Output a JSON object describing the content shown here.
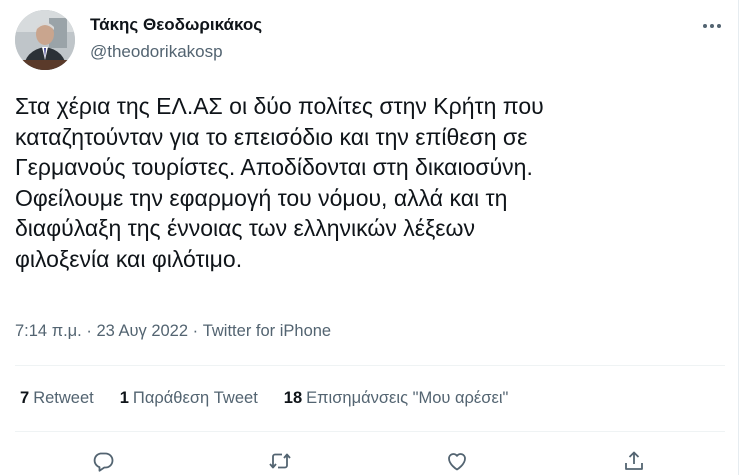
{
  "author": {
    "name": "Τάκης Θεοδωρικάκος",
    "handle": "@theodorikakosp"
  },
  "tweet": {
    "text": "Στα χέρια της ΕΛ.ΑΣ οι δύο πολίτες στην Κρήτη που\nκαταζητούνταν για το επεισόδιο και την επίθεση σε\nΓερμανούς τουρίστες. Αποδίδονται στη δικαιοσύνη.\nΟφείλουμε την εφαρμογή του νόμου, αλλά και τη\nδιαφύλαξη της έννοιας των ελληνικών λέξεων\nφιλοξενία και φιλότιμο.",
    "time": "7:14 π.μ.",
    "separator": " · ",
    "date": "23 Αυγ 2022",
    "source": "Twitter for iPhone"
  },
  "stats": {
    "retweets_count": "7",
    "retweets_label": "Retweet",
    "quotes_count": "1",
    "quotes_label": "Παράθεση Tweet",
    "likes_count": "18",
    "likes_label": "Επισημάνσεις \"Μου αρέσει\""
  },
  "icons": {
    "more": "more-horizontal-icon",
    "reply": "reply-icon",
    "retweet": "retweet-icon",
    "like": "heart-icon",
    "share": "share-icon"
  },
  "colors": {
    "text": "#0f1419",
    "secondary": "#536471",
    "divider": "#eff3f4"
  }
}
